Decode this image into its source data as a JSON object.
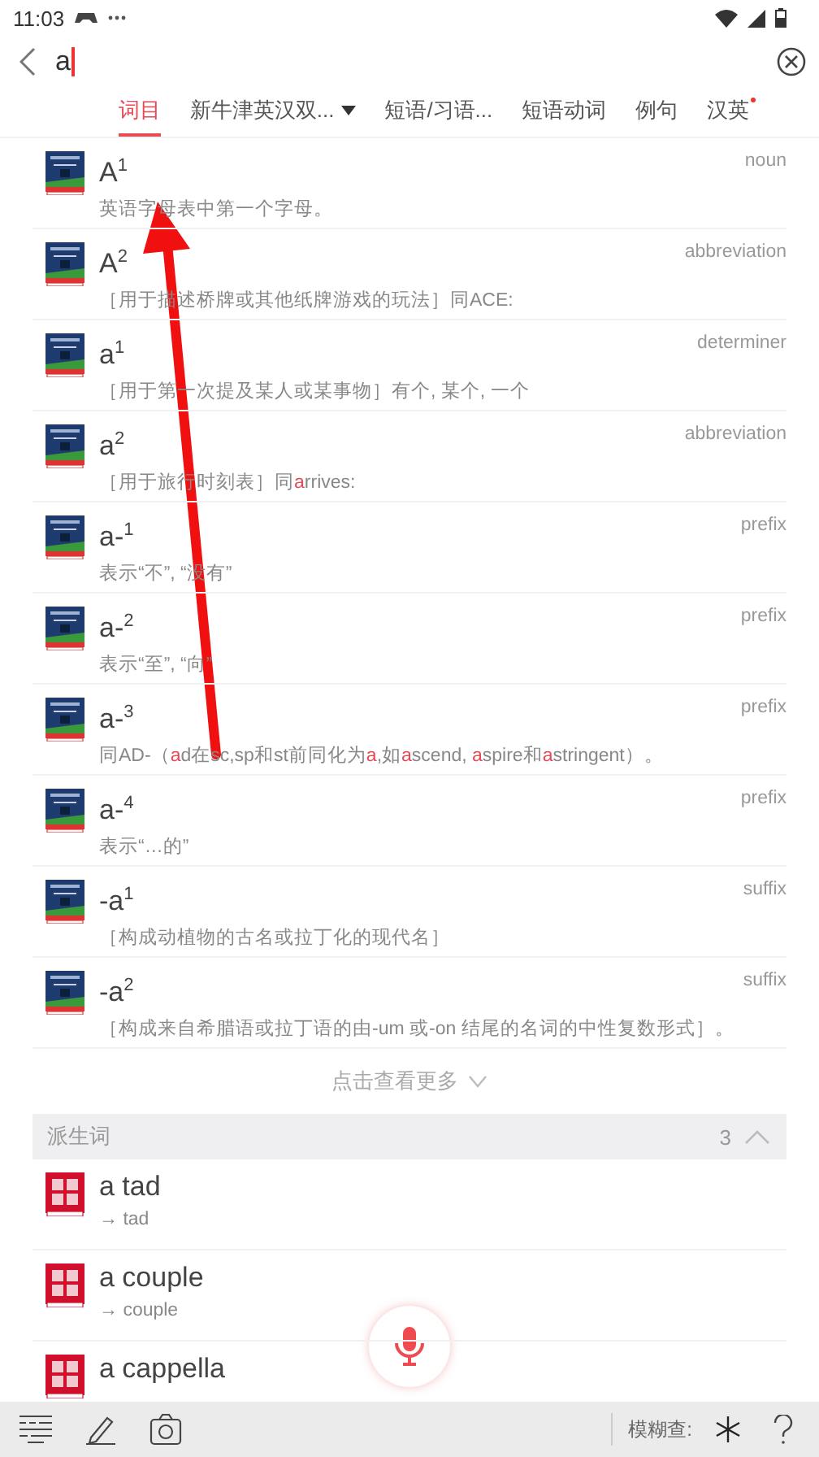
{
  "status_bar": {
    "time": "11:03"
  },
  "search": {
    "value": "a"
  },
  "tabs": [
    {
      "label": "词目",
      "selected": true
    },
    {
      "label": "新牛津英汉双...",
      "selected": false,
      "dropdown": true
    },
    {
      "label": "短语/习语...",
      "selected": false
    },
    {
      "label": "短语动词",
      "selected": false
    },
    {
      "label": "例句",
      "selected": false
    },
    {
      "label": "汉英",
      "selected": false,
      "dot": true
    }
  ],
  "entries": [
    {
      "headword": "A$^{1}$",
      "pos": "noun",
      "definition": [
        {
          "text": "英语字母表中第一个字母。",
          "highlight": false
        }
      ]
    },
    {
      "headword": "A$^{2}$",
      "pos": "abbreviation",
      "definition": [
        {
          "text": "［用于描述桥牌或其他纸牌游戏的玩法］同ACE:",
          "highlight": false
        }
      ]
    },
    {
      "headword": "a$^{1}$",
      "pos": "determiner",
      "definition": [
        {
          "text": "［用于第一次提及某人或某事物］有个, 某个, 一个",
          "highlight": false
        }
      ]
    },
    {
      "headword": "a$^{2}$",
      "pos": "abbreviation",
      "definition": [
        {
          "text": "［用于旅行时刻表］同",
          "highlight": false
        },
        {
          "text": "a",
          "highlight": true
        },
        {
          "text": "rrives:",
          "highlight": false
        }
      ]
    },
    {
      "headword": "a-$^{1}$",
      "pos": "prefix",
      "definition": [
        {
          "text": "表示“不”, “没有”",
          "highlight": false
        }
      ]
    },
    {
      "headword": "a-$^{2}$",
      "pos": "prefix",
      "definition": [
        {
          "text": "表示“至”, “向”",
          "highlight": false
        }
      ]
    },
    {
      "headword": "a-$^{3}$",
      "pos": "prefix",
      "definition": [
        {
          "text": "同AD-（",
          "highlight": false
        },
        {
          "text": "a",
          "highlight": true
        },
        {
          "text": "d在sc,sp和st前同化为",
          "highlight": false
        },
        {
          "text": "a",
          "highlight": true
        },
        {
          "text": ",如",
          "highlight": false
        },
        {
          "text": "a",
          "highlight": true
        },
        {
          "text": "scend, ",
          "highlight": false
        },
        {
          "text": "a",
          "highlight": true
        },
        {
          "text": "spire和",
          "highlight": false
        },
        {
          "text": "a",
          "highlight": true
        },
        {
          "text": "stringent）。",
          "highlight": false
        }
      ]
    },
    {
      "headword": "a-$^{4}$",
      "pos": "prefix",
      "definition": [
        {
          "text": "表示“…的”",
          "highlight": false
        }
      ]
    },
    {
      "headword": "-a$^{1}$",
      "pos": "suffix",
      "definition": [
        {
          "text": "［构成动植物的古名或拉丁化的现代名］",
          "highlight": false
        }
      ]
    },
    {
      "headword": "-a$^{2}$",
      "pos": "suffix",
      "definition": [
        {
          "text": "［构成来自希腊语或拉丁语的由-um 或-on 结尾的名词的中性复数形式］。",
          "highlight": false
        }
      ]
    }
  ],
  "more": "点击查看更多",
  "derived": {
    "title": "派生词",
    "count": "3",
    "expanded": true,
    "items": [
      {
        "headword": "a tad",
        "target": "→ tad"
      },
      {
        "headword": "a couple",
        "target": "→ couple"
      },
      {
        "headword": "a cappella"
      }
    ]
  },
  "bottom_bar": {
    "fuzzy_label": "模糊查:"
  }
}
